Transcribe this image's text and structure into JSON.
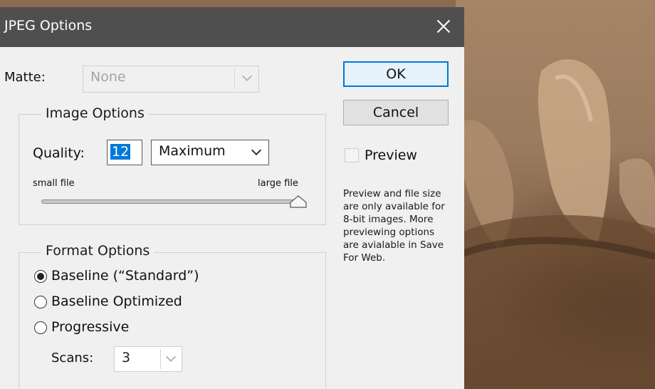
{
  "dialog": {
    "title": "JPEG Options",
    "matte": {
      "label": "Matte:",
      "value": "None"
    },
    "buttons": {
      "ok": "OK",
      "cancel": "Cancel"
    },
    "preview": {
      "label": "Preview",
      "checked": false
    },
    "note": "Preview and file size are only available for 8-bit images. More previewing options are avialable in Save For Web.",
    "image_options": {
      "legend": "Image Options",
      "quality_label": "Quality:",
      "quality_value": "12",
      "quality_preset": "Maximum",
      "small_label": "small file",
      "large_label": "large file",
      "slider_fraction": 1.0
    },
    "format_options": {
      "legend": "Format Options",
      "choices": [
        "Baseline (“Standard”)",
        "Baseline Optimized",
        "Progressive"
      ],
      "selected_index": 0,
      "scans_label": "Scans:",
      "scans_value": "3"
    }
  },
  "colors": {
    "titlebar": "#4f4f4f",
    "accent": "#0078d7",
    "dialog_bg": "#f0f0f0"
  }
}
